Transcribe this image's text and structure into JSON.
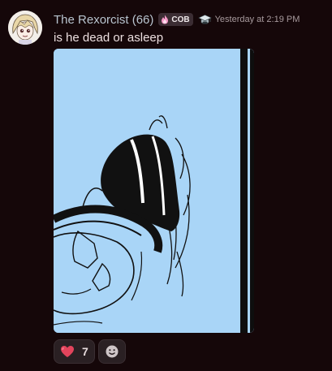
{
  "message": {
    "author": {
      "display_name": "The Rexorcist (66)",
      "tag_label": "COB",
      "tag_icon": "flame-icon",
      "role_icon": "mortarboard-icon",
      "name_color": "#b8c4cf"
    },
    "timestamp": "Yesterday at 2:19 PM",
    "text": "is he dead or asleep",
    "attachment": {
      "type": "image",
      "description": "comic drawing"
    }
  },
  "reactions": [
    {
      "emoji": "heart-icon",
      "count": "7"
    }
  ],
  "add_reaction_icon": "smiley-icon",
  "colors": {
    "background": "#150709",
    "attachment_bg": "#a9d5f7",
    "tag_bg": "#3b2d33",
    "heart": "#e2445c"
  }
}
